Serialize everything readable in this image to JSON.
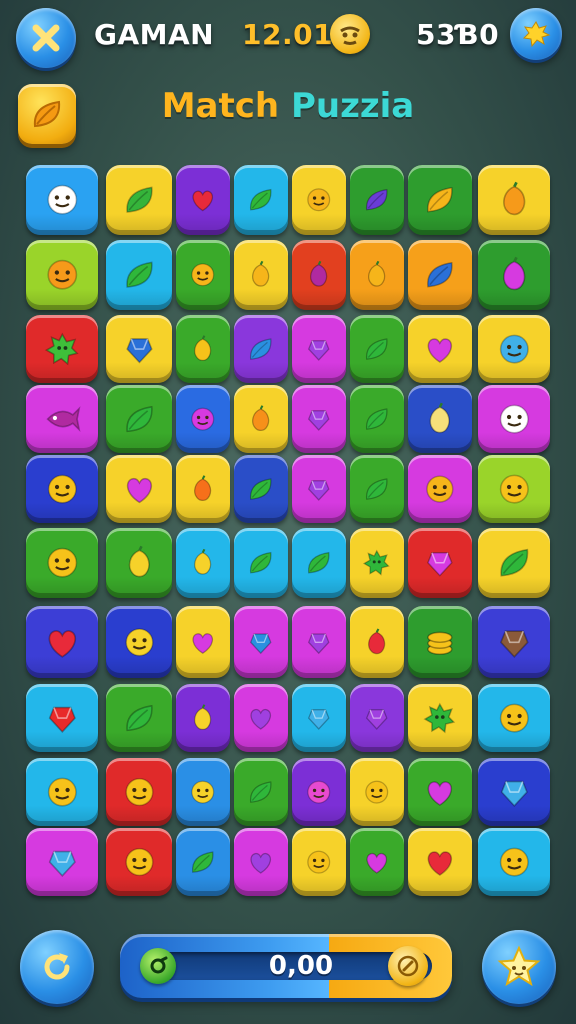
{
  "header": {
    "player_name": "GAMAN",
    "timer": "12.01",
    "score": "53Ɓ0",
    "close_icon": "close-icon",
    "face_icon": "face-coin-icon",
    "settings_icon": "splash-badge-icon"
  },
  "title": {
    "part1": "Match",
    "part2": "Puzzia",
    "color1": "#ffb51e",
    "color2": "#3cd9d6"
  },
  "booster_icon": "leaf-booster-icon",
  "footer": {
    "progress_value": "0,00",
    "progress_fraction": 0.0,
    "refresh_icon": "refresh-icon",
    "star_icon": "star-icon"
  },
  "board": {
    "rows": [
      [
        "face",
        "leaf",
        "heart",
        "leaf",
        "face",
        "leaf",
        "leaf",
        "fruit"
      ],
      [
        "face",
        "leaf",
        "face",
        "fruit",
        "fruit",
        "fruit",
        "leaf",
        "fruit"
      ],
      [
        "splat",
        "gem",
        "fruit",
        "leaf",
        "gem",
        "leaf",
        "heart",
        "face"
      ],
      [
        "fish",
        "leaf",
        "face",
        "fruit",
        "gem",
        "leaf",
        "fruit",
        "face"
      ],
      [
        "face",
        "heart",
        "fruit",
        "leaf",
        "gem",
        "leaf",
        "face",
        "face"
      ],
      [
        "face",
        "fruit",
        "fruit",
        "leaf",
        "leaf",
        "splat",
        "gem",
        "leaf"
      ],
      [
        "heart",
        "face",
        "heart",
        "gem",
        "gem",
        "fruit",
        "coin",
        "gem"
      ],
      [
        "gem",
        "leaf",
        "fruit",
        "heart",
        "gem",
        "gem",
        "splat",
        "face"
      ],
      [
        "face",
        "face",
        "face",
        "leaf",
        "face",
        "face",
        "heart",
        "gem"
      ],
      [
        "gem",
        "face",
        "leaf",
        "heart",
        "face",
        "heart",
        "heart",
        "face"
      ]
    ],
    "colors": [
      [
        "#2aa2f2",
        "#f6d22a",
        "#7c2fd6",
        "#23b7ea",
        "#f6d22a",
        "#2e9d2e",
        "#2e9d2e",
        "#f6d22a"
      ],
      [
        "#9ad42a",
        "#23b7ea",
        "#3aaa2a",
        "#f6d22a",
        "#e2401f",
        "#f6a01a",
        "#f6a01a",
        "#2e9d2e"
      ],
      [
        "#e02a2a",
        "#f6d22a",
        "#3aaa2a",
        "#8a37dc",
        "#d63ae0",
        "#3aaa2a",
        "#f6d22a",
        "#f6d22a"
      ],
      [
        "#d63ae0",
        "#3aaa2a",
        "#2a6be2",
        "#f6d22a",
        "#d63ae0",
        "#3aaa2a",
        "#2a4ec8",
        "#d63ae0"
      ],
      [
        "#2a3ecf",
        "#f6d22a",
        "#f6d22a",
        "#2a4ec8",
        "#d63ae0",
        "#3aaa2a",
        "#d63ae0",
        "#9ad42a"
      ],
      [
        "#3aaa2a",
        "#3aaa2a",
        "#23b7ea",
        "#23b7ea",
        "#23b7ea",
        "#f6d22a",
        "#e02a2a",
        "#f6d22a"
      ],
      [
        "#3c3ed6",
        "#2a3ecf",
        "#f6d22a",
        "#d63ae0",
        "#d63ae0",
        "#f6d22a",
        "#2e9d2e",
        "#3c3ed6"
      ],
      [
        "#23b7ea",
        "#3aaa2a",
        "#7c2fd6",
        "#d63ae0",
        "#23b7ea",
        "#8a37dc",
        "#f6d22a",
        "#23b7ea"
      ],
      [
        "#23b7ea",
        "#e02a2a",
        "#2a8fe6",
        "#3aaa2a",
        "#7c2fd6",
        "#f6d22a",
        "#3aaa2a",
        "#2a3ecf"
      ],
      [
        "#d63ae0",
        "#e02a2a",
        "#2a8fe6",
        "#d63ae0",
        "#f6d22a",
        "#3aaa2a",
        "#f6d22a",
        "#23b7ea"
      ]
    ],
    "symbol_colors": [
      [
        "#ffffff",
        "#35b43a",
        "#e82a3a",
        "#2fb73a",
        "#f6b51a",
        "#6a3cd6",
        "#f6b51a",
        "#f69a1a"
      ],
      [
        "#f69a1a",
        "#2fb73a",
        "#f6b51a",
        "#f6b51a",
        "#b02aa0",
        "#f6b51a",
        "#2a70d8",
        "#d63ae0"
      ],
      [
        "#3fbf3a",
        "#2a70d8",
        "#f6c21a",
        "#2a90e0",
        "#a040e0",
        "#2fb73a",
        "#d63ae0",
        "#40b0e8"
      ],
      [
        "#b02aa0",
        "#2fb73a",
        "#d63ae0",
        "#f6901a",
        "#a040e0",
        "#2fb73a",
        "#f6e07a",
        "#ffffff"
      ],
      [
        "#f6c21a",
        "#d63ae0",
        "#f6701a",
        "#2fb73a",
        "#a040e0",
        "#2fb73a",
        "#f6b51a",
        "#f6c21a"
      ],
      [
        "#f6c21a",
        "#f6d22a",
        "#f6d22a",
        "#2fb73a",
        "#2fb73a",
        "#2fb73a",
        "#d63ae0",
        "#2fb73a"
      ],
      [
        "#e82a3a",
        "#f6d22a",
        "#d63ae0",
        "#2a90e0",
        "#a040e0",
        "#e82a3a",
        "#f6c21a",
        "#8a5a3a"
      ],
      [
        "#e82a2a",
        "#2fb73a",
        "#f6d22a",
        "#a040e0",
        "#40b0e8",
        "#a040e0",
        "#2fb73a",
        "#f6c21a"
      ],
      [
        "#f6c21a",
        "#f6c21a",
        "#f6d22a",
        "#2fb73a",
        "#e84ad0",
        "#f6c21a",
        "#d63ae0",
        "#40b0e8"
      ],
      [
        "#40b0e8",
        "#f6c21a",
        "#2fb73a",
        "#a040e0",
        "#f6c21a",
        "#d63ae0",
        "#e82a3a",
        "#f6c21a"
      ]
    ]
  }
}
